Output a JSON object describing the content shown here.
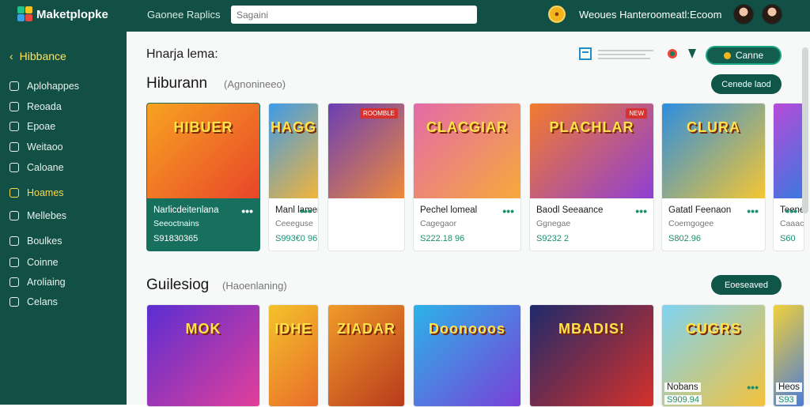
{
  "app": {
    "name": "Maketplopke",
    "nav_label": "Gaonee Raplics",
    "search_placeholder": "Sagaini",
    "user_email": "Weoues Hanteroomeatl:Ecoom",
    "coin_icon": "coin-icon"
  },
  "sidebar": {
    "title": "Hibbance",
    "items": [
      {
        "label": "Aplohappes",
        "icon": "apps-icon"
      },
      {
        "label": "Reoada",
        "icon": "pencil-icon"
      },
      {
        "label": "Epoae",
        "icon": "bag-icon"
      },
      {
        "label": "Weitaoo",
        "icon": "square-icon"
      },
      {
        "label": "Caloane",
        "icon": "doc-icon"
      },
      {
        "label": "Hoames",
        "icon": "folder-icon",
        "active": true
      },
      {
        "label": "Mellebes",
        "icon": "chat-icon"
      },
      {
        "label": "Boulkes",
        "icon": "box-icon"
      },
      {
        "label": "Coinne",
        "icon": "coins-icon"
      },
      {
        "label": "Aroliaing",
        "icon": "home-icon"
      },
      {
        "label": "Celans",
        "icon": "drop-icon"
      }
    ]
  },
  "header": {
    "page_title": "Hnarja lema:",
    "game_button_label": "Canne"
  },
  "sections": [
    {
      "title": "Hiburann",
      "subtitle": "(Agnonineeo)",
      "button_label": "Cenede laod",
      "cards": [
        {
          "thumb_text": "HIBUER",
          "name": "Narlicdeitenlana",
          "developer": "Seeoctnains",
          "price": "S91830365",
          "featured": true,
          "colors": [
            "#f7a320",
            "#e9452a"
          ]
        },
        {
          "thumb_text": "HAGG",
          "name": "Manl lamenl Gi Man",
          "developer": "Ceeeguse",
          "price": "S993€0 96",
          "colors": [
            "#3e9be8",
            "#f3b43a"
          ]
        },
        {
          "thumb_text": "",
          "name": "",
          "developer": "",
          "price": "",
          "badge": "ROOMBLE",
          "colors": [
            "#6a3fb5",
            "#ef8a3a"
          ]
        },
        {
          "thumb_text": "CLACGIAR",
          "name": "Pechel lomeal",
          "developer": "Cagegaor",
          "price": "S222.18 96",
          "colors": [
            "#e46aa8",
            "#f6a93b"
          ]
        },
        {
          "thumb_text": "PLACHLAR",
          "name": "Baodl Seeaance",
          "developer": "Ggnegae",
          "price": "S9232 2",
          "badge": "NEW",
          "colors": [
            "#f37b2d",
            "#8e3fd4"
          ]
        },
        {
          "thumb_text": "CLURA",
          "name": "Gatatl Feenaon",
          "developer": "Coemgogee",
          "price": "S802.96",
          "colors": [
            "#2d8ee0",
            "#f5c632"
          ]
        },
        {
          "thumb_text": "",
          "name": "Teene",
          "developer": "Caaac",
          "price": "S60",
          "colors": [
            "#b84ad8",
            "#3a78e0"
          ]
        }
      ]
    },
    {
      "title": "Guilesiog",
      "subtitle": "(Haoenlaning)",
      "button_label": "Eoeseaved",
      "cards": [
        {
          "thumb_text": "MOK",
          "colors": [
            "#5a2ed1",
            "#e43f9a"
          ]
        },
        {
          "thumb_text": "IDHE",
          "colors": [
            "#f3c22b",
            "#e96b2a"
          ]
        },
        {
          "thumb_text": "ZIADAR",
          "colors": [
            "#f09b2a",
            "#b8391c"
          ]
        },
        {
          "thumb_text": "Doonooos",
          "colors": [
            "#2cb3e8",
            "#7a3fd8"
          ]
        },
        {
          "thumb_text": "MBADIS!",
          "colors": [
            "#1e2a6b",
            "#d6302a"
          ]
        },
        {
          "thumb_text": "CUGRS",
          "name": "Nobans",
          "price": "S909.94",
          "colors": [
            "#7fd3f2",
            "#f4c13b"
          ]
        },
        {
          "thumb_text": "",
          "name": "Heos",
          "price": "S93",
          "colors": [
            "#f1d13a",
            "#4a7bd8"
          ]
        }
      ]
    }
  ],
  "colors": {
    "brand_dark": "#124f45",
    "accent_green": "#1b8f6e",
    "highlight_yellow": "#ffd84a"
  }
}
